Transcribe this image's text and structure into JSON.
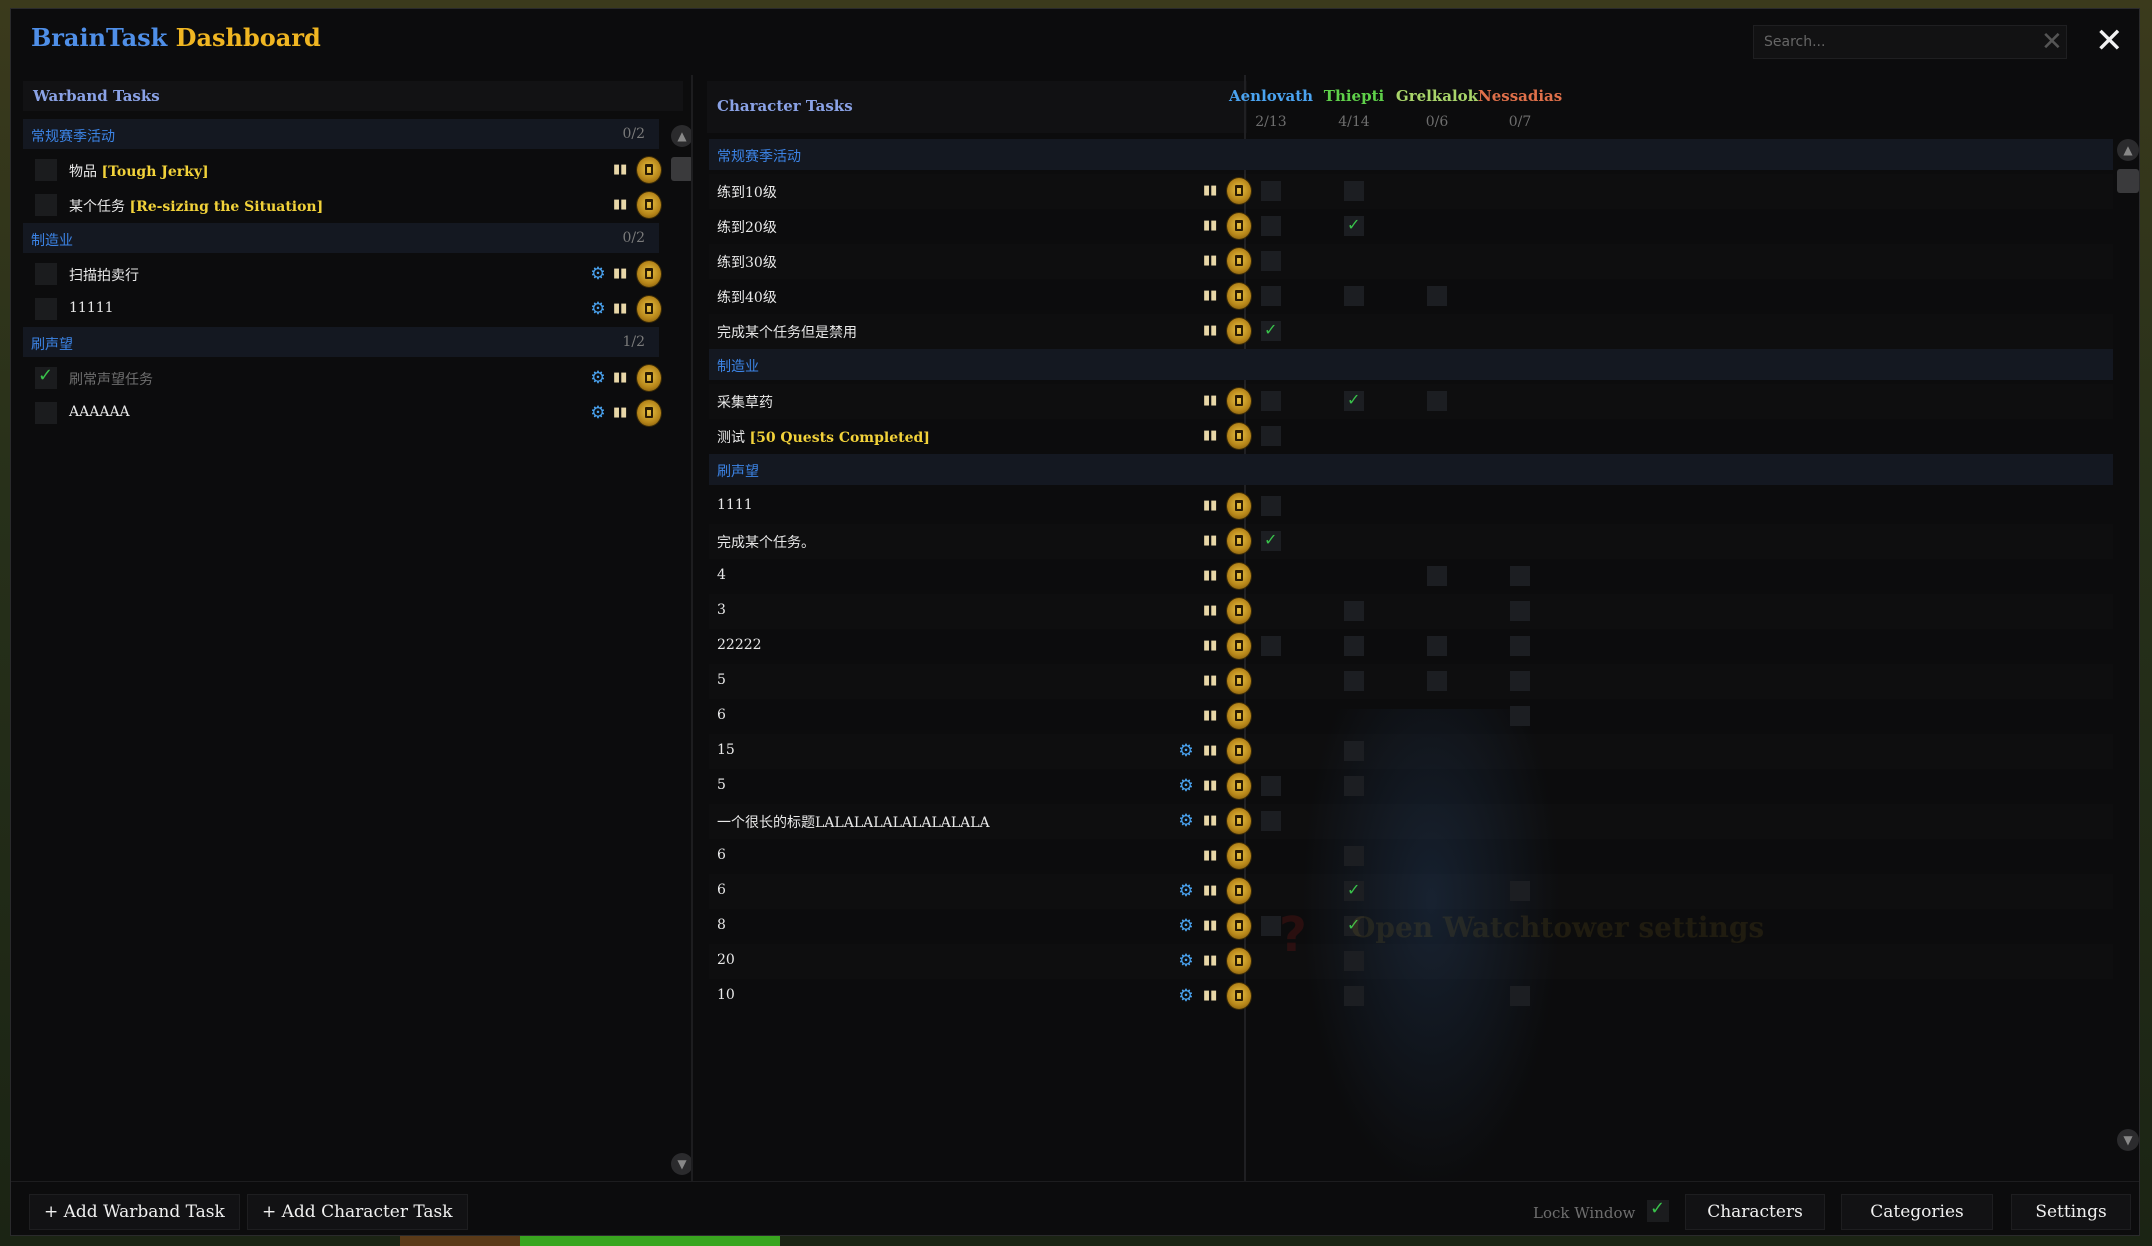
{
  "app": {
    "title_part1": "BrainTask",
    "title_part2": "Dashboard",
    "search_placeholder": "Search..."
  },
  "watermark": "Open Watchtower settings",
  "warband": {
    "header": "Warband Tasks",
    "categories": [
      {
        "name": "常规赛季活动",
        "count": "0/2",
        "tasks": [
          {
            "label": "物品 ",
            "link": "[Tough Jerky]",
            "done": false,
            "gear": false
          },
          {
            "label": "某个任务 ",
            "link": "[Re-sizing the Situation]",
            "done": false,
            "gear": false
          }
        ]
      },
      {
        "name": "制造业",
        "count": "0/2",
        "tasks": [
          {
            "label": "扫描拍卖行",
            "link": "",
            "done": false,
            "gear": true
          },
          {
            "label": "11111",
            "link": "",
            "done": false,
            "gear": true
          }
        ]
      },
      {
        "name": "刷声望",
        "count": "1/2",
        "tasks": [
          {
            "label": "刷常声望任务",
            "link": "",
            "done": true,
            "gear": true
          },
          {
            "label": "AAAAAA",
            "link": "",
            "done": false,
            "gear": true
          }
        ]
      }
    ]
  },
  "character_panel": {
    "header": "Character Tasks",
    "characters": [
      {
        "name": "Aenlovath",
        "count": "2/13",
        "color": "#4aa3f0"
      },
      {
        "name": "Thiepti",
        "count": "4/14",
        "color": "#5fd04a"
      },
      {
        "name": "Grelkalok",
        "count": "0/6",
        "color": "#a9d56a"
      },
      {
        "name": "Nessadias",
        "count": "0/7",
        "color": "#e0704a"
      }
    ],
    "categories": [
      {
        "name": "常规赛季活动",
        "tasks": [
          {
            "label": "练到10级",
            "link": "",
            "gear": false,
            "cells": [
              "off",
              "off",
              "none",
              "none"
            ]
          },
          {
            "label": "练到20级",
            "link": "",
            "gear": false,
            "cells": [
              "off",
              "on",
              "none",
              "none"
            ]
          },
          {
            "label": "练到30级",
            "link": "",
            "gear": false,
            "cells": [
              "off",
              "none",
              "none",
              "none"
            ]
          },
          {
            "label": "练到40级",
            "link": "",
            "gear": false,
            "cells": [
              "off",
              "off",
              "off",
              "none"
            ]
          },
          {
            "label": "完成某个任务但是禁用",
            "link": "",
            "gear": false,
            "cells": [
              "on",
              "none",
              "none",
              "none"
            ]
          }
        ]
      },
      {
        "name": "制造业",
        "tasks": [
          {
            "label": "采集草药",
            "link": "",
            "gear": false,
            "cells": [
              "off",
              "on",
              "off",
              "none"
            ]
          },
          {
            "label": "测试 ",
            "link": "[50 Quests Completed]",
            "gear": false,
            "cells": [
              "off",
              "none",
              "none",
              "none"
            ]
          }
        ]
      },
      {
        "name": "刷声望",
        "tasks": [
          {
            "label": "1111",
            "link": "",
            "gear": false,
            "cells": [
              "off",
              "none",
              "none",
              "none"
            ]
          },
          {
            "label": "完成某个任务。",
            "link": "",
            "gear": false,
            "cells": [
              "on",
              "none",
              "none",
              "none"
            ]
          },
          {
            "label": "4",
            "link": "",
            "gear": false,
            "cells": [
              "none",
              "none",
              "off",
              "off"
            ]
          },
          {
            "label": "3",
            "link": "",
            "gear": false,
            "cells": [
              "none",
              "off",
              "none",
              "off"
            ]
          },
          {
            "label": "22222",
            "link": "",
            "gear": false,
            "cells": [
              "off",
              "off",
              "off",
              "off"
            ]
          },
          {
            "label": "5",
            "link": "",
            "gear": false,
            "cells": [
              "none",
              "off",
              "off",
              "off"
            ]
          },
          {
            "label": "6",
            "link": "",
            "gear": false,
            "cells": [
              "none",
              "none",
              "none",
              "off"
            ]
          },
          {
            "label": "15",
            "link": "",
            "gear": true,
            "cells": [
              "none",
              "off",
              "none",
              "none"
            ]
          },
          {
            "label": "5",
            "link": "",
            "gear": true,
            "cells": [
              "off",
              "off",
              "none",
              "none"
            ]
          },
          {
            "label": "一个很长的标题LALALALALALALALALA",
            "link": "",
            "gear": true,
            "cells": [
              "off",
              "none",
              "none",
              "none"
            ]
          },
          {
            "label": "6",
            "link": "",
            "gear": false,
            "cells": [
              "none",
              "off",
              "none",
              "none"
            ]
          },
          {
            "label": "6",
            "link": "",
            "gear": true,
            "cells": [
              "none",
              "on",
              "none",
              "off"
            ]
          },
          {
            "label": "8",
            "link": "",
            "gear": true,
            "cells": [
              "off",
              "on",
              "none",
              "none"
            ]
          },
          {
            "label": "20",
            "link": "",
            "gear": true,
            "cells": [
              "none",
              "off",
              "none",
              "none"
            ]
          },
          {
            "label": "10",
            "link": "",
            "gear": true,
            "cells": [
              "none",
              "off",
              "none",
              "off"
            ]
          }
        ]
      }
    ]
  },
  "bottom": {
    "add_warband": "+ Add Warband Task",
    "add_character": "+ Add Character Task",
    "lock_window": "Lock Window",
    "lock_checked": true,
    "characters_btn": "Characters",
    "categories_btn": "Categories",
    "settings_btn": "Settings"
  },
  "icons": {
    "gear": "gear-icon",
    "book": "book-icon",
    "trash": "trash-icon",
    "close": "close-icon",
    "clear": "clear-search-icon"
  }
}
